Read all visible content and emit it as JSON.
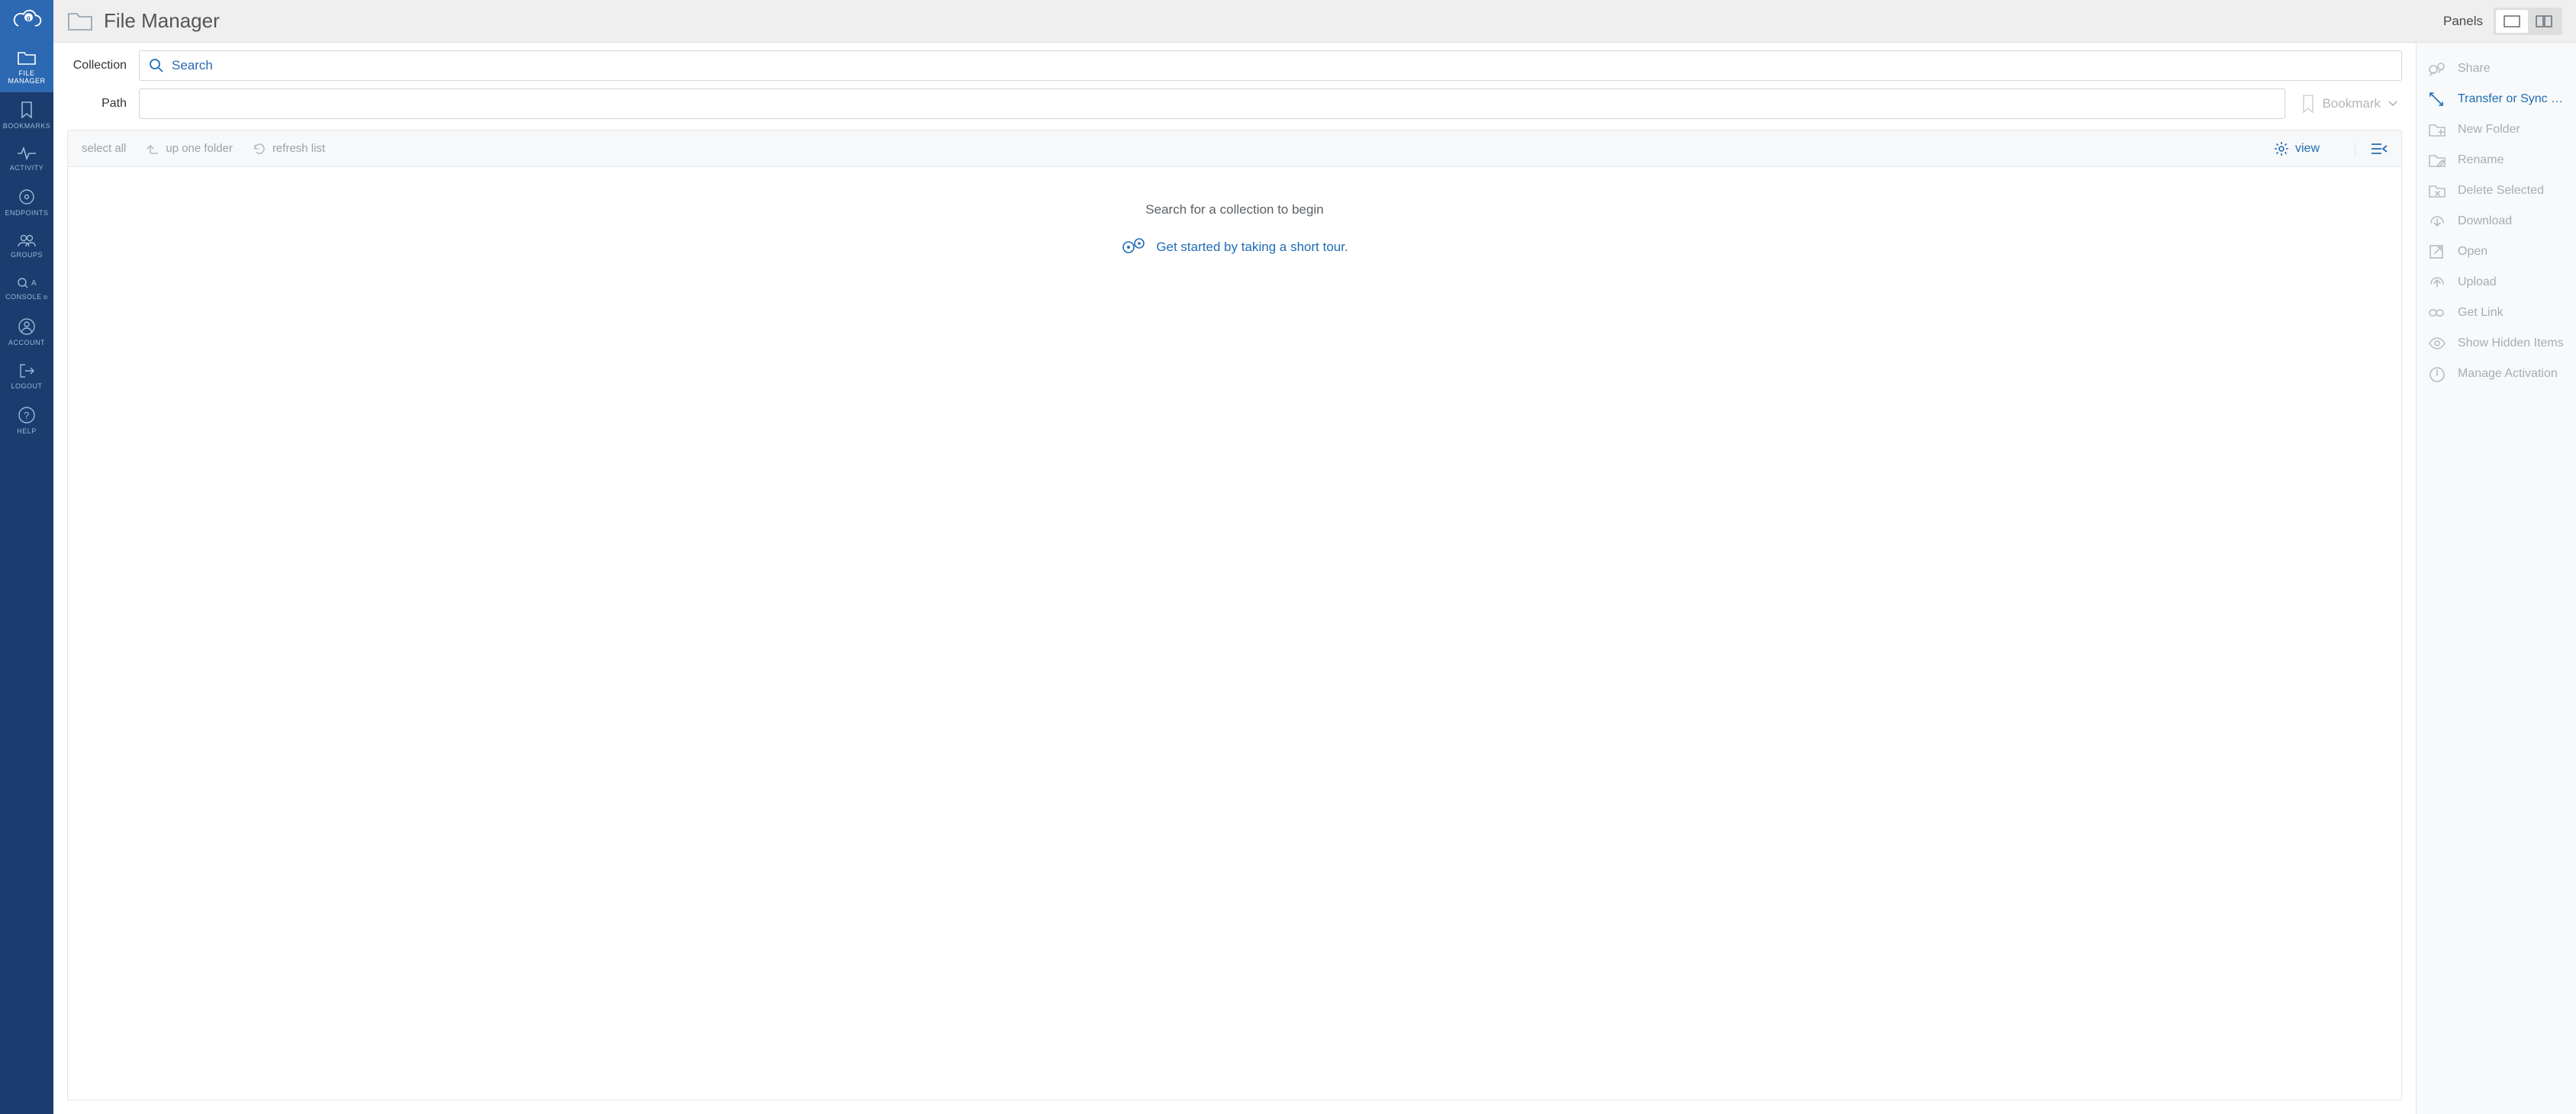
{
  "header": {
    "title": "File Manager",
    "panels_label": "Panels"
  },
  "nav": {
    "items": [
      {
        "label": "FILE MANAGER"
      },
      {
        "label": "BOOKMARKS"
      },
      {
        "label": "ACTIVITY"
      },
      {
        "label": "ENDPOINTS"
      },
      {
        "label": "GROUPS"
      },
      {
        "label": "CONSOLE"
      },
      {
        "label": "ACCOUNT"
      },
      {
        "label": "LOGOUT"
      },
      {
        "label": "HELP"
      }
    ]
  },
  "fields": {
    "collection_label": "Collection",
    "collection_placeholder": "Search",
    "collection_value": "",
    "path_label": "Path",
    "path_value": "",
    "bookmark_label": "Bookmark"
  },
  "toolbar": {
    "select_all": "select all",
    "up_one": "up one folder",
    "refresh": "refresh list",
    "view": "view"
  },
  "empty": {
    "message": "Search for a collection to begin",
    "tour": "Get started by taking a short tour."
  },
  "actions": [
    {
      "label": "Share",
      "enabled": false,
      "icon": "share"
    },
    {
      "label": "Transfer or Sync to...",
      "enabled": true,
      "icon": "transfer"
    },
    {
      "label": "New Folder",
      "enabled": false,
      "icon": "newfolder"
    },
    {
      "label": "Rename",
      "enabled": false,
      "icon": "rename"
    },
    {
      "label": "Delete Selected",
      "enabled": false,
      "icon": "delete"
    },
    {
      "label": "Download",
      "enabled": false,
      "icon": "download"
    },
    {
      "label": "Open",
      "enabled": false,
      "icon": "open"
    },
    {
      "label": "Upload",
      "enabled": false,
      "icon": "upload"
    },
    {
      "label": "Get Link",
      "enabled": false,
      "icon": "link"
    },
    {
      "label": "Show Hidden Items",
      "enabled": false,
      "icon": "eye"
    },
    {
      "label": "Manage Activation",
      "enabled": false,
      "icon": "power"
    }
  ]
}
